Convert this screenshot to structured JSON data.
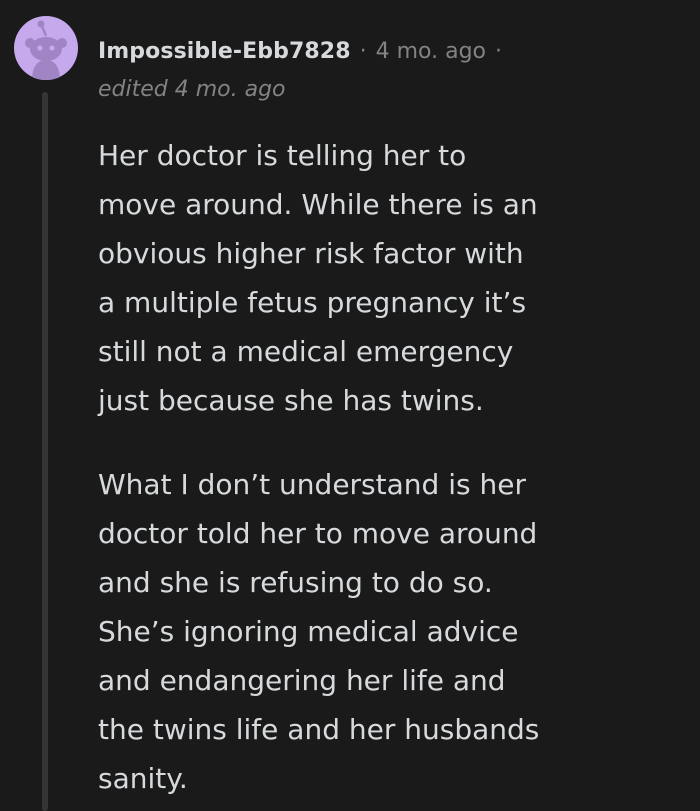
{
  "comment": {
    "username": "Impossible-Ebb7828",
    "separator": "·",
    "timestamp": "4 mo. ago",
    "edited": "edited 4 mo. ago",
    "paragraphs": [
      [
        "Her doctor is telling her to",
        "move around. While there is an",
        "obvious higher risk factor with",
        "a multiple fetus pregnancy it’s",
        "still not a medical emergency",
        "just because she has twins."
      ],
      [
        "What I don’t understand is her",
        "doctor told her to move around",
        "and she is refusing to do so.",
        "She’s ignoring medical advice",
        "and endangering her life and",
        "the twins life and her husbands",
        "sanity."
      ]
    ]
  },
  "avatar": {
    "icon": "reddit-snoo-icon",
    "background_color": "#c6a8ec",
    "figure_color": "#a085c4"
  },
  "colors": {
    "background": "#1a1a1b",
    "text": "#d7dadc",
    "muted": "#818384",
    "thread_line": "#343536"
  }
}
